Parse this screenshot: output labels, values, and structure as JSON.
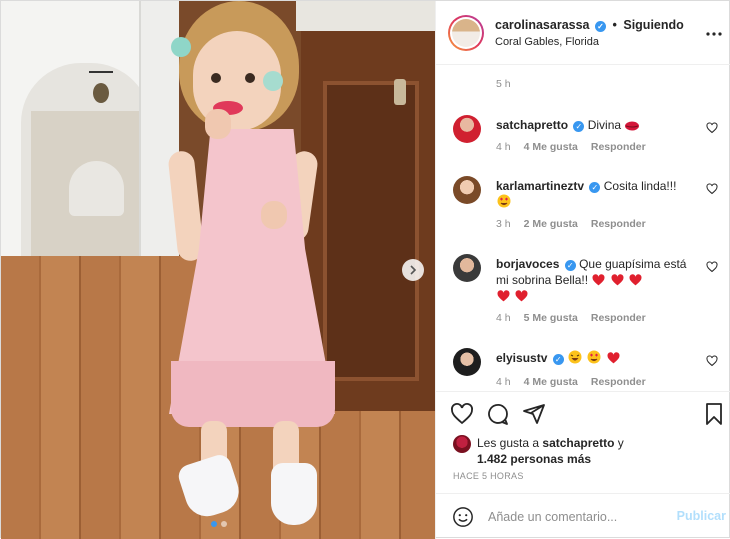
{
  "post": {
    "username": "carolinasarassa",
    "verified": true,
    "follow_separator": "•",
    "follow_label": "Siguiendo",
    "location": "Coral Gables, Florida",
    "caption_time": "5 h"
  },
  "comments": [
    {
      "user": "satchapretto",
      "text": "Divina",
      "emoji": [
        "lips"
      ],
      "time": "4 h",
      "likes": "4 Me gusta",
      "reply": "Responder"
    },
    {
      "user": "karlamartineztv",
      "text": "Cosita linda!!!",
      "emoji": [
        "heart-eyes"
      ],
      "time": "3 h",
      "likes": "2 Me gusta",
      "reply": "Responder"
    },
    {
      "user": "borjavoces",
      "text": "Que guapísima está mi sobrina Bella!!",
      "emoji": [
        "heart",
        "heart",
        "heart",
        "heart",
        "heart"
      ],
      "time": "4 h",
      "likes": "5 Me gusta",
      "reply": "Responder"
    },
    {
      "user": "elyisustv",
      "text": "",
      "emoji": [
        "laugh",
        "heart-eyes",
        "heart"
      ],
      "time": "4 h",
      "likes": "4 Me gusta",
      "reply": "Responder"
    }
  ],
  "likes": {
    "prefix": "Les gusta a",
    "first_user": "satchapretto",
    "connector": "y",
    "others": "1.482 personas más"
  },
  "time_ago": "HACE 5 HORAS",
  "composer": {
    "placeholder": "Añade un comentario...",
    "publish_label": "Publicar"
  },
  "icons": {
    "more": "more-options-icon",
    "like": "heart-icon",
    "comment": "comment-icon",
    "share": "share-icon",
    "save": "bookmark-icon",
    "emoji": "smile-icon",
    "next": "chevron-right-icon"
  },
  "colors": {
    "verified": "#3897f0",
    "heart_red": "#ed4956",
    "publish_disabled": "#b2dffc",
    "secondary_text": "#8e8e8e"
  },
  "carousel": {
    "count": 2,
    "active": 0
  }
}
